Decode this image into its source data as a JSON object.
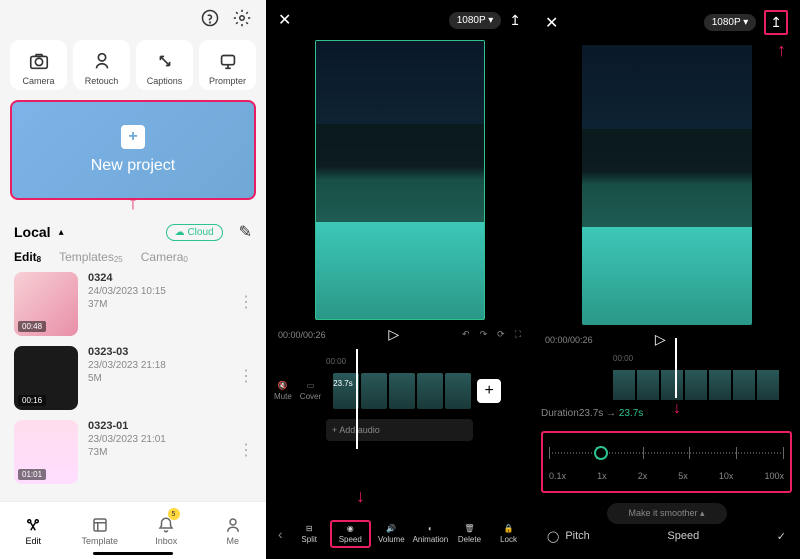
{
  "panel1": {
    "tools": [
      {
        "label": "Camera",
        "name": "camera-tool"
      },
      {
        "label": "Retouch",
        "name": "retouch-tool"
      },
      {
        "label": "Captions",
        "name": "captions-tool"
      },
      {
        "label": "Prompter",
        "name": "prompter-tool"
      }
    ],
    "newProject": "New project",
    "local": "Local",
    "cloud": "Cloud",
    "tabs": [
      {
        "label": "Edit",
        "count": "8",
        "active": true
      },
      {
        "label": "Templates",
        "count": "25",
        "active": false
      },
      {
        "label": "Camera",
        "count": "0",
        "active": false
      }
    ],
    "projects": [
      {
        "name": "0324",
        "date": "24/03/2023 10:15",
        "size": "37M",
        "duration": "00:48"
      },
      {
        "name": "0323-03",
        "date": "23/03/2023 21:18",
        "size": "5M",
        "duration": "00:16"
      },
      {
        "name": "0323-01",
        "date": "23/03/2023 21:01",
        "size": "73M",
        "duration": "01:01"
      }
    ],
    "nav": [
      {
        "label": "Edit",
        "name": "nav-edit"
      },
      {
        "label": "Template",
        "name": "nav-template"
      },
      {
        "label": "Inbox",
        "name": "nav-inbox",
        "badge": "5"
      },
      {
        "label": "Me",
        "name": "nav-me"
      }
    ]
  },
  "panel2": {
    "resolution": "1080P",
    "time": {
      "current": "00:00",
      "total": "00:26"
    },
    "rulerStart": "00:00",
    "mute": "Mute",
    "cover": "Cover",
    "clipDur": "23.7s",
    "addAudio": "+ Add audio",
    "tools": [
      {
        "label": "Split",
        "name": "split-tool"
      },
      {
        "label": "Speed",
        "name": "speed-tool",
        "hl": true
      },
      {
        "label": "Volume",
        "name": "volume-tool"
      },
      {
        "label": "Animation",
        "name": "animation-tool"
      },
      {
        "label": "Delete",
        "name": "delete-tool"
      },
      {
        "label": "Lock",
        "name": "lock-tool"
      }
    ]
  },
  "panel3": {
    "resolution": "1080P",
    "time": {
      "current": "00:00",
      "total": "00:26"
    },
    "rulerStart": "00:00",
    "durationLabel": "Duration",
    "durationOrig": "23.7s",
    "durationNew": "23.7s",
    "speedMarks": [
      "0.1x",
      "1x",
      "2x",
      "5x",
      "10x",
      "100x"
    ],
    "smoother": "Make it smoother",
    "pitch": "Pitch",
    "speedTitle": "Speed"
  }
}
